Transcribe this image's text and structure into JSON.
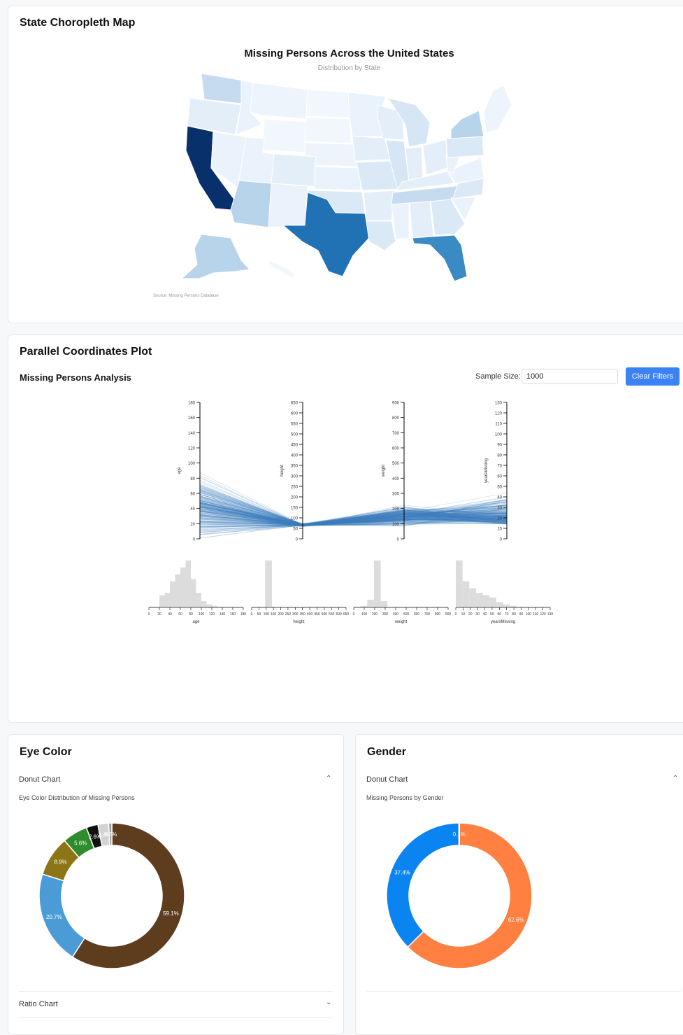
{
  "choropleth": {
    "section_title": "State Choropleth Map",
    "title": "Missing Persons Across the United States",
    "subtitle": "Distribution by State",
    "source": "Source: Missing Persons Database"
  },
  "parallel": {
    "section_title": "Parallel Coordinates Plot",
    "heading": "Missing Persons Analysis",
    "sample_label": "Sample Size:",
    "sample_value": "1000",
    "clear_button": "Clear Filters",
    "axes": [
      {
        "name": "age",
        "ticks": [
          "0",
          "20",
          "40",
          "60",
          "80",
          "100",
          "120",
          "140",
          "160",
          "180"
        ]
      },
      {
        "name": "height",
        "ticks": [
          "0",
          "50",
          "100",
          "150",
          "200",
          "250",
          "300",
          "350",
          "400",
          "450",
          "500",
          "550",
          "600",
          "650"
        ]
      },
      {
        "name": "weight",
        "ticks": [
          "0",
          "100",
          "200",
          "300",
          "400",
          "500",
          "600",
          "700",
          "800",
          "900"
        ]
      },
      {
        "name": "yearsMissing",
        "ticks": [
          "0",
          "10",
          "20",
          "30",
          "40",
          "50",
          "60",
          "70",
          "80",
          "90",
          "100",
          "110",
          "120",
          "130"
        ]
      }
    ],
    "hist_ticks": [
      [
        "0",
        "20",
        "40",
        "60",
        "80",
        "100",
        "120",
        "140",
        "160",
        "180"
      ],
      [
        "0",
        "50",
        "100",
        "150",
        "200",
        "250",
        "300",
        "350",
        "400",
        "450",
        "500",
        "550",
        "600",
        "650"
      ],
      [
        "0",
        "100",
        "200",
        "300",
        "400",
        "500",
        "600",
        "700",
        "800",
        "900"
      ],
      [
        "0",
        "10",
        "20",
        "30",
        "40",
        "50",
        "60",
        "70",
        "80",
        "90",
        "100",
        "110",
        "120",
        "130"
      ]
    ],
    "hist_labels": [
      "age",
      "height",
      "weight",
      "yearsMissing"
    ]
  },
  "eye_color": {
    "section_title": "Eye Color",
    "accordion_open": "Donut Chart",
    "chart_subtitle": "Eye Color Distribution of Missing Persons",
    "accordion_closed": "Ratio Chart"
  },
  "gender": {
    "section_title": "Gender",
    "accordion_open": "Donut Chart",
    "chart_subtitle": "Missing Persons by Gender"
  },
  "chart_data": [
    {
      "type": "pie",
      "title": "Eye Color Distribution of Missing Persons",
      "slices": [
        {
          "value": 59.1,
          "label": "59.1%",
          "color": "#5e3d1e"
        },
        {
          "value": 20.7,
          "label": "20.7%",
          "color": "#4a9bd6"
        },
        {
          "value": 8.9,
          "label": "8.9%",
          "color": "#8b7516"
        },
        {
          "value": 5.6,
          "label": "5.6%",
          "color": "#2e8b2e"
        },
        {
          "value": 2.6,
          "label": "2.6%",
          "color": "#111111"
        },
        {
          "value": 2.4,
          "label": "2.4%",
          "color": "#d3d3d3"
        },
        {
          "value": 0.7,
          "label": "0.7%",
          "color": "#9a9a9a"
        }
      ]
    },
    {
      "type": "pie",
      "title": "Missing Persons by Gender",
      "slices": [
        {
          "value": 62.6,
          "label": "62.6%",
          "color": "#ff8040"
        },
        {
          "value": 37.4,
          "label": "37.4%",
          "color": "#0a84f0"
        },
        {
          "value": 0.1,
          "label": "0.1%",
          "color": "#ffd080"
        }
      ]
    }
  ]
}
